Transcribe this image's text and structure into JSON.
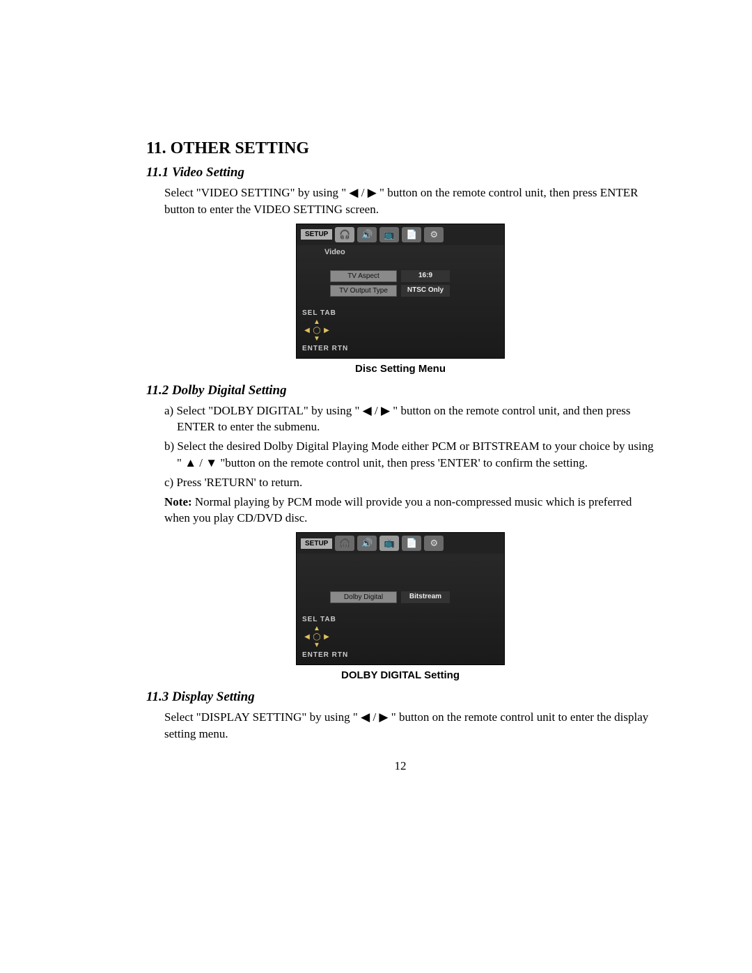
{
  "page_number": "12",
  "heading": "11. OTHER SETTING",
  "sections": {
    "s1": {
      "title": "11.1 Video Setting",
      "para1a": "Select \"VIDEO SETTING\" by using \" ",
      "para1b": " \" button on the remote control unit, then press ENTER button to enter the VIDEO SETTING screen.",
      "caption": "Disc Setting Menu",
      "osd": {
        "setup": "SETUP",
        "section_label": "Video",
        "rows": [
          {
            "field": "TV Aspect",
            "value": "16:9"
          },
          {
            "field": "TV Output Type",
            "value": "NTSC Only"
          }
        ],
        "sel_tab": "SEL  TAB",
        "enter_rtn": "ENTER  RTN"
      }
    },
    "s2": {
      "title": "11.2 Dolby Digital Setting",
      "item_a_pre": "a) Select \"DOLBY DIGITAL\" by using \" ",
      "item_a_post": " \" button on the remote control unit, and then press ENTER to enter the submenu.",
      "item_b_pre": "b) Select the desired Dolby Digital Playing Mode either PCM or BITSTREAM to your choice by using \" ",
      "item_b_post": " \"button on the remote control unit, then press 'ENTER' to confirm the setting.",
      "item_c": "c) Press 'RETURN' to return.",
      "note_label": "Note:",
      "note_body": " Normal playing by PCM mode will provide you a non-compressed music which is preferred when you play CD/DVD disc.",
      "caption": "DOLBY DIGITAL Setting",
      "osd": {
        "setup": "SETUP",
        "section_label": "",
        "rows": [
          {
            "field": "Dolby Digital",
            "value": "Bitstream"
          }
        ],
        "sel_tab": "SEL  TAB",
        "enter_rtn": "ENTER  RTN"
      }
    },
    "s3": {
      "title": "11.3 Display Setting",
      "para_pre": "Select \"DISPLAY SETTING\" by using \" ",
      "para_post": " \" button on the remote control unit to enter the display setting menu."
    }
  },
  "glyphs": {
    "left_right": "◀ / ▶",
    "up_down": "▲ / ▼"
  },
  "icons": {
    "tabs": [
      "🎧",
      "🔊",
      "📺",
      "📄",
      "⚙"
    ]
  }
}
